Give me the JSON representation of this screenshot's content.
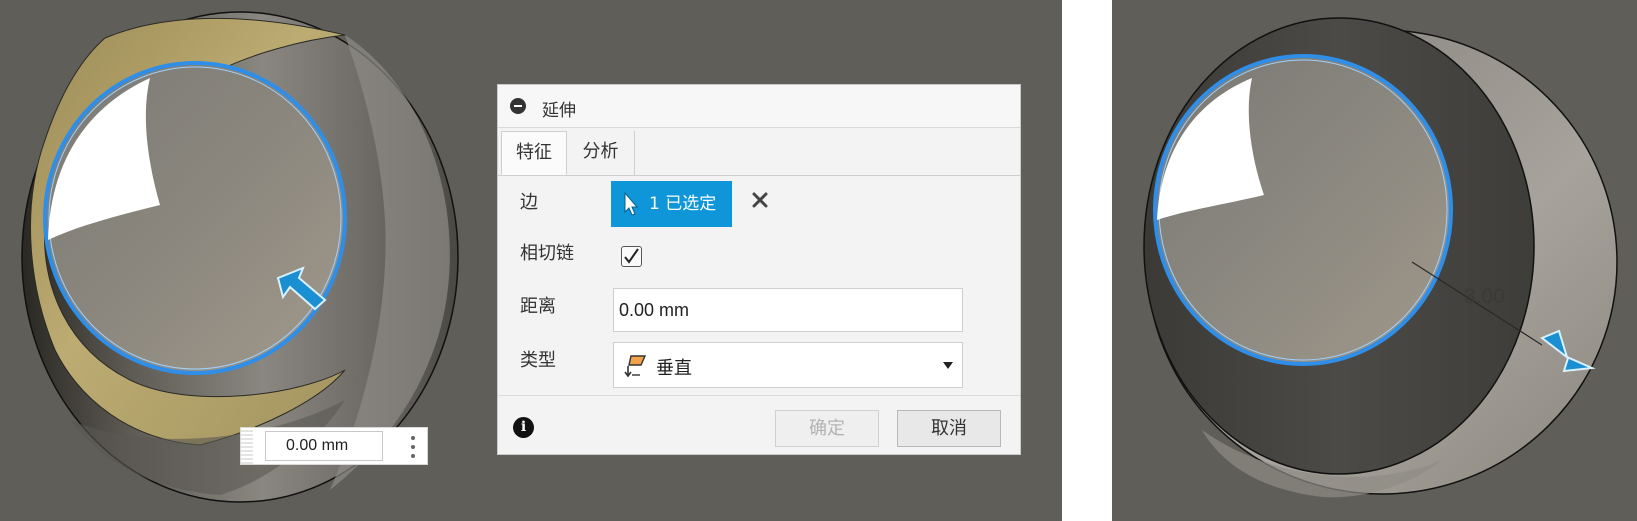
{
  "viewport_left": {
    "floating_field": {
      "value": "0.00 mm"
    }
  },
  "dialog": {
    "title": "延伸",
    "tabs": [
      {
        "label": "特征",
        "active": true
      },
      {
        "label": "分析",
        "active": false
      }
    ],
    "rows": {
      "edge": {
        "label": "边",
        "selection_text": "1 已选定"
      },
      "tangent_chain": {
        "label": "相切链",
        "checked": true
      },
      "distance": {
        "label": "距离",
        "value": "0.00 mm"
      },
      "type": {
        "label": "类型",
        "value": "垂直"
      }
    },
    "buttons": {
      "ok": "确定",
      "cancel": "取消"
    }
  },
  "viewport_right": {
    "dimension_label": "3.00"
  },
  "colors": {
    "viewport_bg": "#5f5e58",
    "selection_blue": "#0e96d8",
    "edge_highlight": "#2f8fe8",
    "face_highlight": "#b9a86e"
  }
}
